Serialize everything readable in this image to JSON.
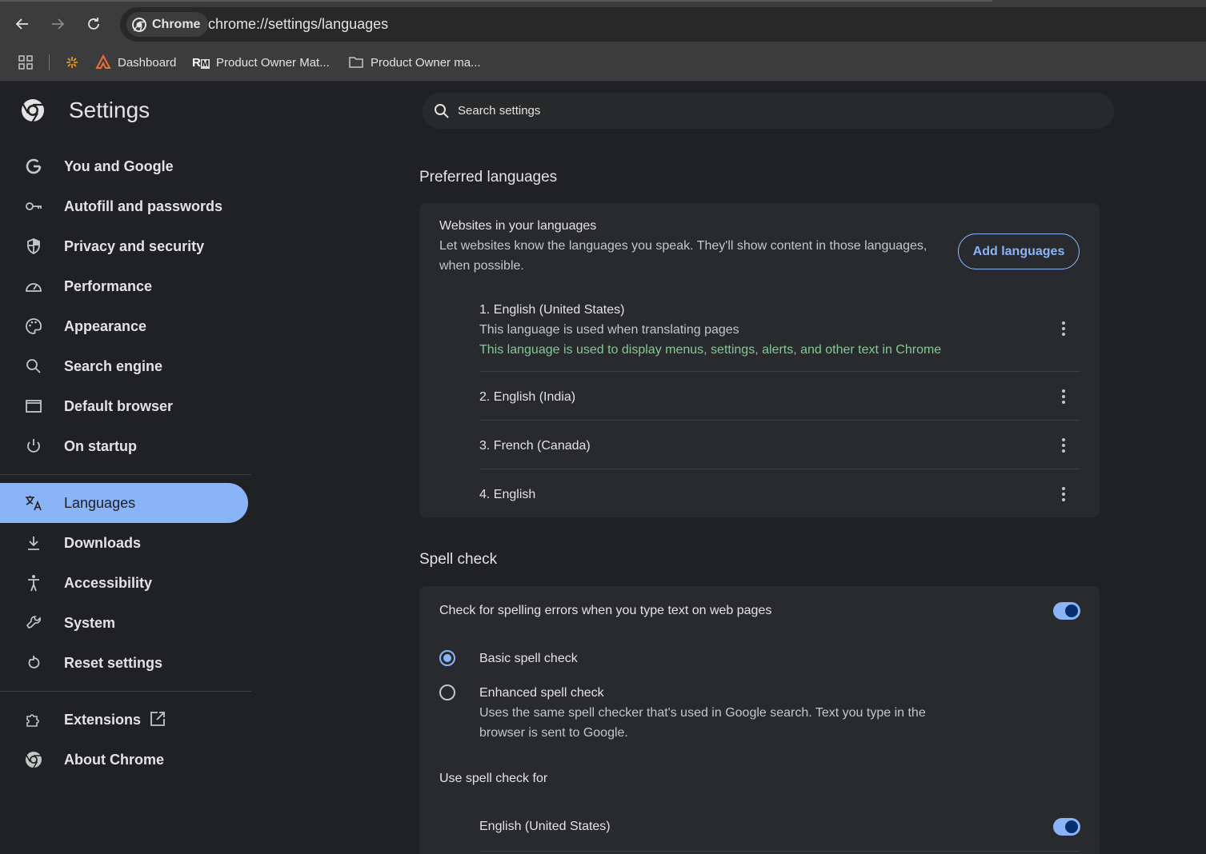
{
  "browser": {
    "chip_label": "Chrome",
    "url": "chrome://settings/languages"
  },
  "bookmarks": [
    {
      "label": "Dashboard",
      "icon": "dashboard-logo-icon"
    },
    {
      "label": "Product Owner Mat...",
      "icon": "rm-logo-icon"
    },
    {
      "label": "Product Owner ma...",
      "icon": "folder-icon"
    }
  ],
  "settings": {
    "title": "Settings",
    "search_placeholder": "Search settings"
  },
  "nav": {
    "items": [
      {
        "label": "You and Google",
        "icon": "google-g-icon"
      },
      {
        "label": "Autofill and passwords",
        "icon": "key-icon"
      },
      {
        "label": "Privacy and security",
        "icon": "shield-icon"
      },
      {
        "label": "Performance",
        "icon": "speedometer-icon"
      },
      {
        "label": "Appearance",
        "icon": "palette-icon"
      },
      {
        "label": "Search engine",
        "icon": "search-icon"
      },
      {
        "label": "Default browser",
        "icon": "browser-window-icon"
      },
      {
        "label": "On startup",
        "icon": "power-icon"
      },
      {
        "label": "Languages",
        "icon": "translate-icon",
        "active": true
      },
      {
        "label": "Downloads",
        "icon": "download-icon"
      },
      {
        "label": "Accessibility",
        "icon": "accessibility-icon"
      },
      {
        "label": "System",
        "icon": "wrench-icon"
      },
      {
        "label": "Reset settings",
        "icon": "reset-icon"
      },
      {
        "label": "Extensions",
        "icon": "puzzle-icon"
      },
      {
        "label": "About Chrome",
        "icon": "chrome-logo-icon"
      }
    ]
  },
  "preferred_languages": {
    "section_title": "Preferred languages",
    "card_title": "Websites in your languages",
    "card_desc_line1": "Let websites know the languages you speak. They'll show content in those languages,",
    "card_desc_line2": "when possible.",
    "add_button": "Add languages",
    "languages": [
      {
        "label": "1. English (United States)",
        "note": "This language is used when translating pages",
        "ui_note": "This language is used to display menus, settings, alerts, and other text in Chrome"
      },
      {
        "label": "2. English (India)"
      },
      {
        "label": "3. French (Canada)"
      },
      {
        "label": "4. English"
      }
    ]
  },
  "spell_check": {
    "section_title": "Spell check",
    "toggle_label": "Check for spelling errors when you type text on web pages",
    "toggle_on": true,
    "basic_label": "Basic spell check",
    "enhanced_label": "Enhanced spell check",
    "enhanced_desc_line1": "Uses the same spell checker that's used in Google search. Text you type in the",
    "enhanced_desc_line2": "browser is sent to Google.",
    "selected": "basic",
    "use_for_label": "Use spell check for",
    "use_for_items": [
      {
        "label": "English (United States)",
        "on": true
      }
    ]
  },
  "colors": {
    "accent": "#8ab4f8",
    "background": "#202124",
    "card": "#292a2d",
    "green_text": "#81c995"
  }
}
